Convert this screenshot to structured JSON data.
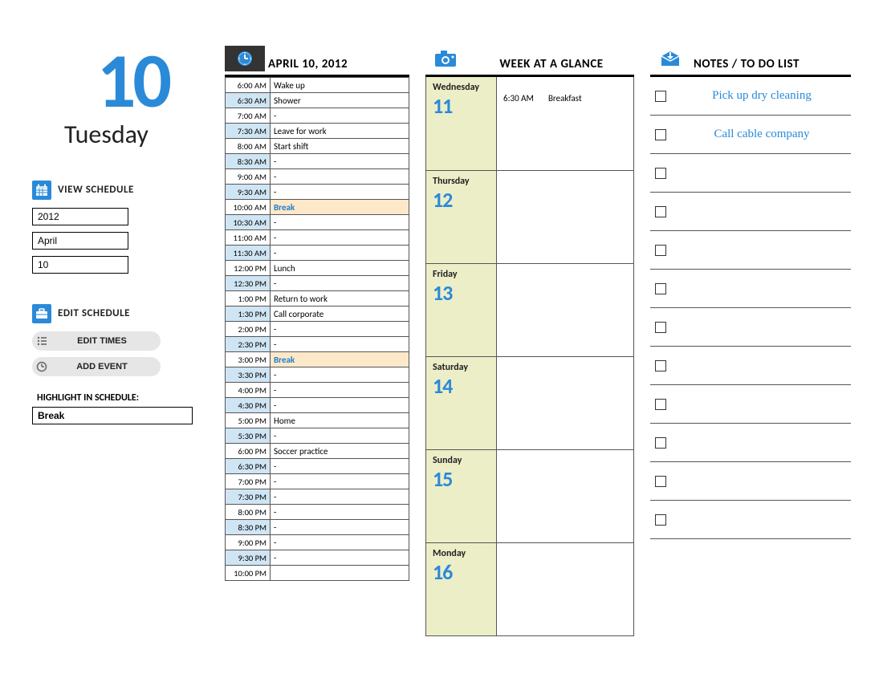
{
  "date": {
    "day_number": "10",
    "weekday": "Tuesday"
  },
  "sidebar": {
    "view_label": "VIEW SCHEDULE",
    "edit_label": "EDIT SCHEDULE",
    "year_input": "2012",
    "month_input": "April",
    "day_input": "10",
    "edit_times_btn": "EDIT TIMES",
    "add_event_btn": "ADD EVENT",
    "highlight_label": "HIGHLIGHT IN SCHEDULE:",
    "highlight_value": "Break"
  },
  "daily": {
    "header": "APRIL 10, 2012",
    "highlight_term": "Break",
    "slots": [
      {
        "time": "6:00 AM",
        "event": "Wake up"
      },
      {
        "time": "6:30 AM",
        "event": "Shower"
      },
      {
        "time": "7:00 AM",
        "event": "-"
      },
      {
        "time": "7:30 AM",
        "event": "Leave for work"
      },
      {
        "time": "8:00 AM",
        "event": "Start shift"
      },
      {
        "time": "8:30 AM",
        "event": "-"
      },
      {
        "time": "9:00 AM",
        "event": "-"
      },
      {
        "time": "9:30 AM",
        "event": "-"
      },
      {
        "time": "10:00 AM",
        "event": "Break"
      },
      {
        "time": "10:30 AM",
        "event": "-"
      },
      {
        "time": "11:00 AM",
        "event": "-"
      },
      {
        "time": "11:30 AM",
        "event": "-"
      },
      {
        "time": "12:00 PM",
        "event": "Lunch"
      },
      {
        "time": "12:30 PM",
        "event": "-"
      },
      {
        "time": "1:00 PM",
        "event": "Return to work"
      },
      {
        "time": "1:30 PM",
        "event": "Call corporate"
      },
      {
        "time": "2:00 PM",
        "event": "-"
      },
      {
        "time": "2:30 PM",
        "event": "-"
      },
      {
        "time": "3:00 PM",
        "event": "Break"
      },
      {
        "time": "3:30 PM",
        "event": "-"
      },
      {
        "time": "4:00 PM",
        "event": "-"
      },
      {
        "time": "4:30 PM",
        "event": "-"
      },
      {
        "time": "5:00 PM",
        "event": "Home"
      },
      {
        "time": "5:30 PM",
        "event": "-"
      },
      {
        "time": "6:00 PM",
        "event": "Soccer practice"
      },
      {
        "time": "6:30 PM",
        "event": "-"
      },
      {
        "time": "7:00 PM",
        "event": "-"
      },
      {
        "time": "7:30 PM",
        "event": "-"
      },
      {
        "time": "8:00 PM",
        "event": "-"
      },
      {
        "time": "8:30 PM",
        "event": "-"
      },
      {
        "time": "9:00 PM",
        "event": "-"
      },
      {
        "time": "9:30 PM",
        "event": "-"
      },
      {
        "time": "10:00 PM",
        "event": ""
      }
    ]
  },
  "week": {
    "header": "WEEK AT A GLANCE",
    "days": [
      {
        "name": "Wednesday",
        "num": "11",
        "events": [
          {
            "time": "6:30 AM",
            "text": "Breakfast"
          }
        ]
      },
      {
        "name": "Thursday",
        "num": "12",
        "events": []
      },
      {
        "name": "Friday",
        "num": "13",
        "events": []
      },
      {
        "name": "Saturday",
        "num": "14",
        "events": []
      },
      {
        "name": "Sunday",
        "num": "15",
        "events": []
      },
      {
        "name": "Monday",
        "num": "16",
        "events": []
      }
    ]
  },
  "notes": {
    "header": "NOTES / TO DO LIST",
    "items": [
      {
        "text": "Pick up dry cleaning",
        "checked": false
      },
      {
        "text": "Call cable company",
        "checked": false
      },
      {
        "text": "",
        "checked": false
      },
      {
        "text": "",
        "checked": false
      },
      {
        "text": "",
        "checked": false
      },
      {
        "text": "",
        "checked": false
      },
      {
        "text": "",
        "checked": false
      },
      {
        "text": "",
        "checked": false
      },
      {
        "text": "",
        "checked": false
      },
      {
        "text": "",
        "checked": false
      },
      {
        "text": "",
        "checked": false
      },
      {
        "text": "",
        "checked": false
      }
    ]
  }
}
